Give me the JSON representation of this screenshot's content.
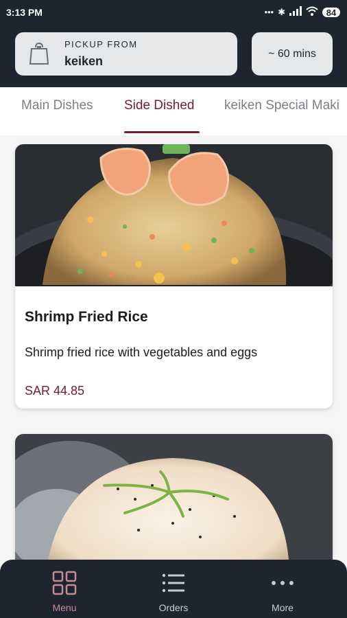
{
  "status_bar": {
    "time": "3:13 PM",
    "battery": "84"
  },
  "pickup": {
    "label": "PICKUP FROM",
    "store": "keiken"
  },
  "eta": "~ 60 mins",
  "tabs": [
    {
      "label": "Main Dishes",
      "active": false
    },
    {
      "label": "Side Dished",
      "active": true
    },
    {
      "label": "keiken Special Maki",
      "active": false
    }
  ],
  "dishes": [
    {
      "title": "Shrimp Fried Rice",
      "description": "Shrimp fried rice with vegetables and eggs",
      "price": "SAR 44.85"
    },
    {
      "title": "",
      "description": "",
      "price": ""
    }
  ],
  "bottom_nav": [
    {
      "label": "Menu",
      "icon": "grid-icon",
      "active": true
    },
    {
      "label": "Orders",
      "icon": "list-icon",
      "active": false
    },
    {
      "label": "More",
      "icon": "more-dots-icon",
      "active": false
    }
  ],
  "colors": {
    "header_bg": "#1f2530",
    "accent": "#7a1a2a",
    "nav_active": "#c58c95"
  }
}
